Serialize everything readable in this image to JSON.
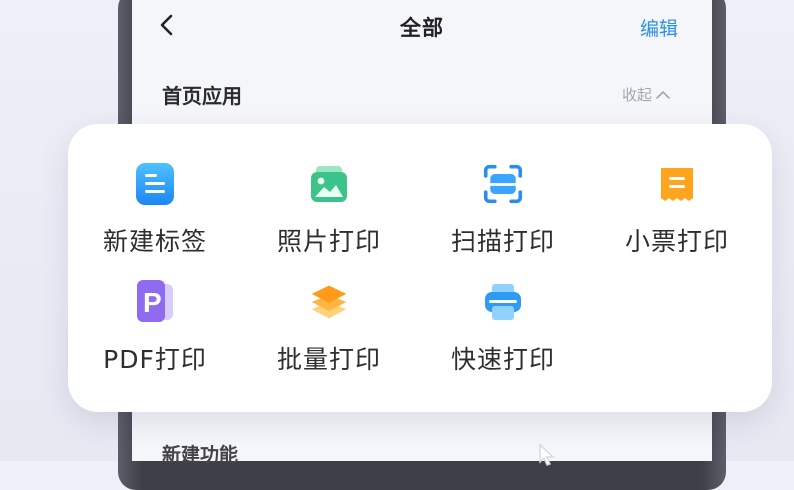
{
  "header": {
    "title": "全部",
    "edit_label": "编辑"
  },
  "section": {
    "title": "首页应用",
    "collapse_label": "收起"
  },
  "next_section": {
    "title": "新建功能"
  },
  "apps": [
    {
      "label": "新建标签",
      "icon": "note-icon"
    },
    {
      "label": "照片打印",
      "icon": "photo-icon"
    },
    {
      "label": "扫描打印",
      "icon": "scan-icon"
    },
    {
      "label": "小票打印",
      "icon": "receipt-icon"
    },
    {
      "label": "PDF打印",
      "icon": "pdf-icon"
    },
    {
      "label": "批量打印",
      "icon": "layers-icon"
    },
    {
      "label": "快速打印",
      "icon": "printer-icon"
    }
  ],
  "colors": {
    "accent": "#2a8fe6",
    "photo_green": "#3cc38a",
    "receipt_orange": "#ffa41c",
    "pdf_purple": "#8e6bf0",
    "layers_orange": "#ff9a1a"
  }
}
